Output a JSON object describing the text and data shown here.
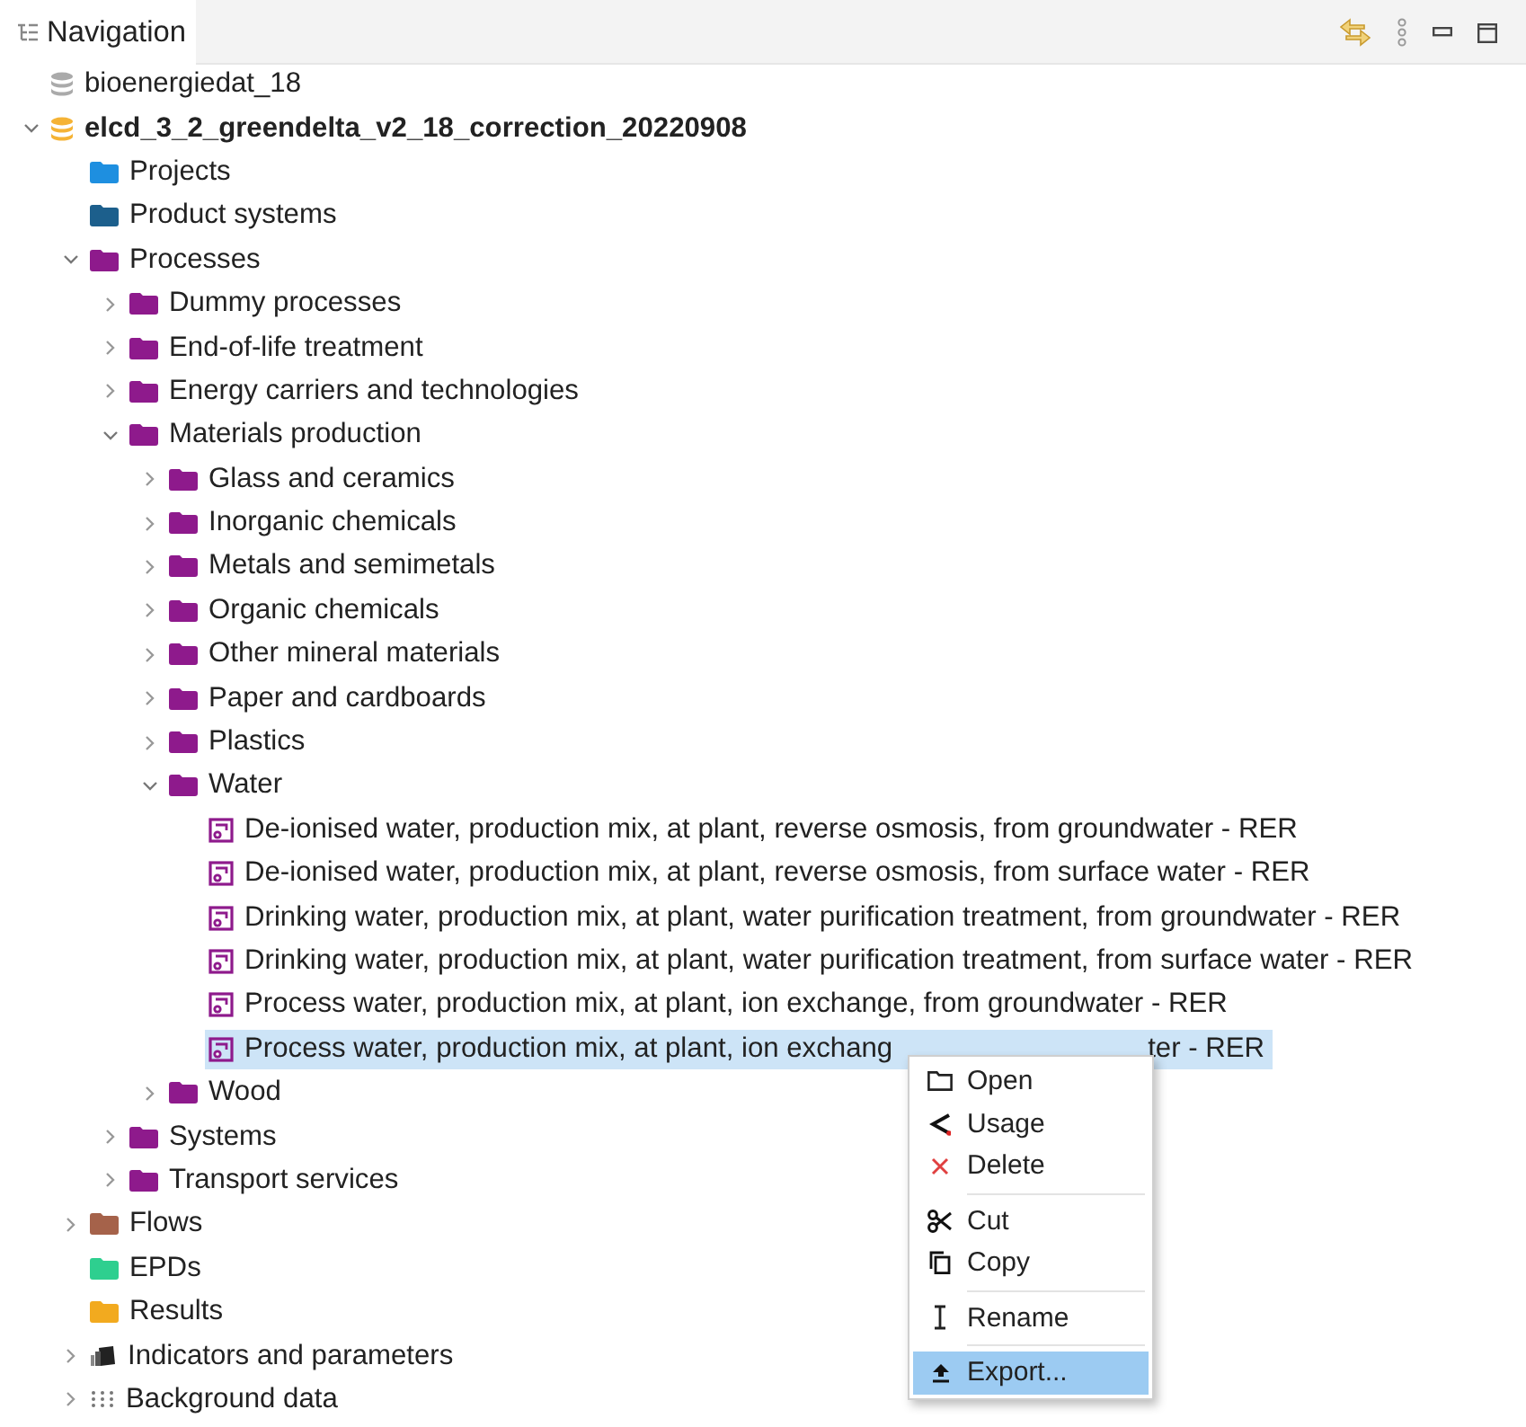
{
  "panel": {
    "title": "Navigation"
  },
  "tree": [
    {
      "label": "bioenergiedat_18",
      "kind": "database",
      "active": false,
      "selected": false
    },
    {
      "label": "elcd_3_2_greendelta_v2_18_correction_20220908",
      "kind": "database",
      "active": true,
      "selected": false,
      "expanded": true,
      "children": [
        {
          "label": "Projects",
          "kind": "folder",
          "color": "#1e8fe0",
          "selected": false
        },
        {
          "label": "Product systems",
          "kind": "folder",
          "color": "#1c5f8c",
          "selected": false
        },
        {
          "label": "Processes",
          "kind": "folder",
          "color": "#8e1a8c",
          "selected": false,
          "expanded": true,
          "children": [
            {
              "label": "Dummy processes",
              "kind": "folder",
              "color": "#8e1a8c",
              "selected": false,
              "expanded": false
            },
            {
              "label": "End-of-life treatment",
              "kind": "folder",
              "color": "#8e1a8c",
              "selected": false,
              "expanded": false
            },
            {
              "label": "Energy carriers and technologies",
              "kind": "folder",
              "color": "#8e1a8c",
              "selected": false,
              "expanded": false
            },
            {
              "label": "Materials production",
              "kind": "folder",
              "color": "#8e1a8c",
              "selected": false,
              "expanded": true,
              "children": [
                {
                  "label": "Glass and ceramics",
                  "kind": "folder",
                  "color": "#8e1a8c",
                  "selected": false,
                  "expanded": false
                },
                {
                  "label": "Inorganic chemicals",
                  "kind": "folder",
                  "color": "#8e1a8c",
                  "selected": false,
                  "expanded": false
                },
                {
                  "label": "Metals and semimetals",
                  "kind": "folder",
                  "color": "#8e1a8c",
                  "selected": false,
                  "expanded": false
                },
                {
                  "label": "Organic chemicals",
                  "kind": "folder",
                  "color": "#8e1a8c",
                  "selected": false,
                  "expanded": false
                },
                {
                  "label": "Other mineral materials",
                  "kind": "folder",
                  "color": "#8e1a8c",
                  "selected": false,
                  "expanded": false
                },
                {
                  "label": "Paper and cardboards",
                  "kind": "folder",
                  "color": "#8e1a8c",
                  "selected": false,
                  "expanded": false
                },
                {
                  "label": "Plastics",
                  "kind": "folder",
                  "color": "#8e1a8c",
                  "selected": false,
                  "expanded": false
                },
                {
                  "label": "Water",
                  "kind": "folder",
                  "color": "#8e1a8c",
                  "selected": false,
                  "expanded": true,
                  "children": [
                    {
                      "label": "De-ionised water, production mix, at plant, reverse osmosis, from groundwater - RER",
                      "kind": "process",
                      "selected": false
                    },
                    {
                      "label": "De-ionised water, production mix, at plant, reverse osmosis, from surface water - RER",
                      "kind": "process",
                      "selected": false
                    },
                    {
                      "label": "Drinking water, production mix, at plant, water purification treatment, from groundwater - RER",
                      "kind": "process",
                      "selected": false
                    },
                    {
                      "label": "Drinking water, production mix, at plant, water purification treatment, from surface water - RER",
                      "kind": "process",
                      "selected": false
                    },
                    {
                      "label": "Process water, production mix, at plant, ion exchange, from groundwater - RER",
                      "kind": "process",
                      "selected": false
                    },
                    {
                      "label": "Process water, production mix, at plant, ion exchang",
                      "label_tail": "ter - RER",
                      "kind": "process",
                      "selected": true
                    }
                  ]
                },
                {
                  "label": "Wood",
                  "kind": "folder",
                  "color": "#8e1a8c",
                  "selected": false,
                  "expanded": false
                }
              ]
            },
            {
              "label": "Systems",
              "kind": "folder",
              "color": "#8e1a8c",
              "selected": false,
              "expanded": false
            },
            {
              "label": "Transport services",
              "kind": "folder",
              "color": "#8e1a8c",
              "selected": false,
              "expanded": false
            }
          ]
        },
        {
          "label": "Flows",
          "kind": "folder",
          "color": "#a5624a",
          "selected": false,
          "expanded": false
        },
        {
          "label": "EPDs",
          "kind": "folder",
          "color": "#2ecf8f",
          "selected": false
        },
        {
          "label": "Results",
          "kind": "folder",
          "color": "#f2aa1f",
          "selected": false
        },
        {
          "label": "Indicators and parameters",
          "kind": "indicators",
          "selected": false,
          "expanded": false
        },
        {
          "label": "Background data",
          "kind": "background",
          "selected": false,
          "expanded": false
        }
      ]
    }
  ],
  "context_menu": [
    {
      "label": "Open",
      "kind": "open",
      "selected": false
    },
    {
      "label": "Usage",
      "kind": "usage",
      "selected": false
    },
    {
      "label": "Delete",
      "kind": "delete",
      "selected": false,
      "separator_after": true
    },
    {
      "label": "Cut",
      "kind": "cut",
      "selected": false
    },
    {
      "label": "Copy",
      "kind": "copy",
      "selected": false,
      "separator_after": true
    },
    {
      "label": "Rename",
      "kind": "rename",
      "selected": false,
      "separator_after": true
    },
    {
      "label": "Export...",
      "kind": "export",
      "selected": true
    }
  ]
}
